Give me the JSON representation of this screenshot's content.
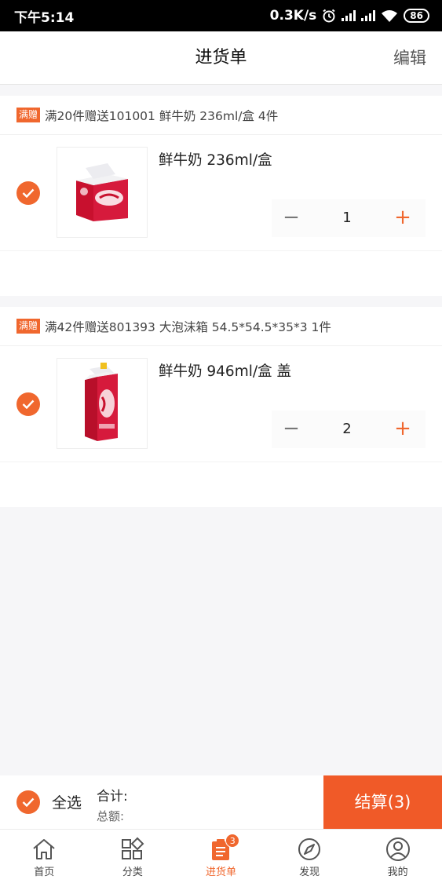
{
  "status_bar": {
    "time": "下午5:14",
    "network_speed": "0.3K/s",
    "battery": "86"
  },
  "header": {
    "title": "进货单",
    "edit_label": "编辑"
  },
  "groups": [
    {
      "promo_tag": "满赠",
      "promo_text": "满20件赠送101001 鲜牛奶 236ml/盒  4件",
      "item": {
        "name": "鲜牛奶 236ml/盒",
        "quantity": "1",
        "minus_symbol": "−",
        "plus_symbol": "+",
        "checked": true,
        "image_icon": "milk-carton-small"
      }
    },
    {
      "promo_tag": "满赠",
      "promo_text": "满42件赠送801393 大泡沫箱 54.5*54.5*35*3  1件",
      "item": {
        "name": "鲜牛奶 946ml/盒 盖",
        "quantity": "2",
        "minus_symbol": "−",
        "plus_symbol": "+",
        "checked": true,
        "image_icon": "milk-carton-tall"
      }
    }
  ],
  "action_bar": {
    "select_all_label": "全选",
    "total_label": "合计:",
    "amount_label": "总额:",
    "checkout_label": "结算(3)"
  },
  "tab_bar": {
    "tabs": [
      {
        "label": "首页",
        "icon": "home-icon"
      },
      {
        "label": "分类",
        "icon": "category-icon"
      },
      {
        "label": "进货单",
        "icon": "order-list-icon",
        "badge": "3",
        "active": true
      },
      {
        "label": "发现",
        "icon": "compass-icon"
      },
      {
        "label": "我的",
        "icon": "user-icon"
      }
    ]
  },
  "colors": {
    "accent": "#f0672e",
    "checkout_bg": "#f05a28"
  }
}
